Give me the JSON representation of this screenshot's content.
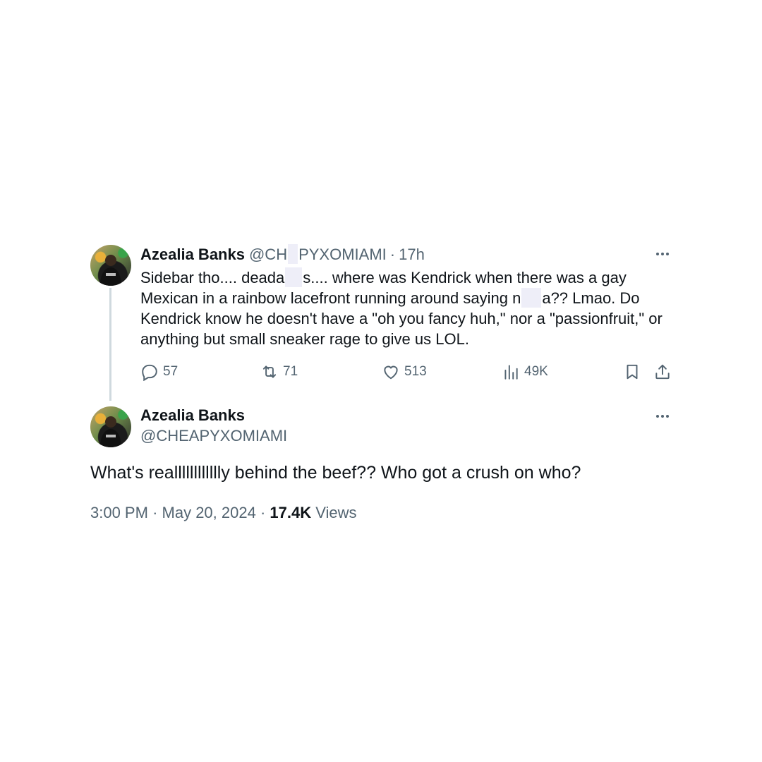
{
  "reply_tweet": {
    "author_name": "Azealia Banks",
    "handle_prefix": "@CH",
    "handle_suffix": "PYXOMIAMI",
    "separator": "·",
    "time_ago": "17h",
    "text_lines": [
      [
        "Sidebar tho.... deada",
        "s.... where was Kendrick when there was a gay"
      ],
      [
        "Mexican in a rainbow lacefront running around saying n",
        "a?? Lmao. Do"
      ],
      [
        "Kendrick know he doesn't have a \"oh you fancy huh,\" nor a \"passionfruit,\" or"
      ],
      [
        "anything but small sneaker rage to give us LOL."
      ]
    ],
    "replies": "57",
    "reposts": "71",
    "likes": "513",
    "views": "49K"
  },
  "main_tweet": {
    "author_name": "Azealia Banks",
    "handle": "@CHEAPYXOMIAMI",
    "text": "What's realllllllllllly behind the beef?? Who got a crush on who?",
    "time": "3:00 PM",
    "date": "May 20, 2024",
    "view_count": "17.4K",
    "views_label": "Views"
  },
  "icons": [
    "avatar",
    "more-icon",
    "reply-icon",
    "repost-icon",
    "like-icon",
    "views-icon",
    "bookmark-icon",
    "share-icon"
  ],
  "colors": {
    "text": "#0f1419",
    "muted": "#536471",
    "thread_line": "#cfd9de",
    "censor": "#eeeef8"
  }
}
